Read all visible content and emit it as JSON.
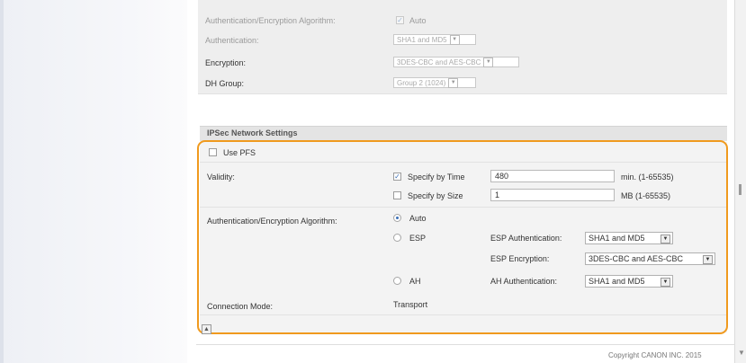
{
  "top_section": {
    "rows": [
      {
        "label": "Authentication/Encryption Algorithm:",
        "value": "Auto",
        "faded": true,
        "checked": true
      },
      {
        "label": "Authentication:",
        "value": "SHA1 and MD5",
        "faded": false
      },
      {
        "label": "Encryption:",
        "value": "3DES-CBC and AES-CBC",
        "faded": false
      },
      {
        "label": "DH Group:",
        "value": "Group 2 (1024)",
        "faded": false
      }
    ]
  },
  "ipsec": {
    "title": "IPSec Network Settings",
    "use_pfs": {
      "label": "Use PFS",
      "checked": false
    },
    "validity": {
      "label": "Validity:",
      "by_time": {
        "label": "Specify by Time",
        "checked": true,
        "value": "480",
        "unit": "min. (1-65535)"
      },
      "by_size": {
        "label": "Specify by Size",
        "checked": false,
        "value": "1",
        "unit": "MB (1-65535)"
      }
    },
    "auth_enc": {
      "label": "Authentication/Encryption Algorithm:",
      "auto": {
        "label": "Auto",
        "selected": true
      },
      "esp": {
        "label": "ESP",
        "selected": false,
        "auth_label": "ESP Authentication:",
        "auth_value": "SHA1 and MD5",
        "enc_label": "ESP Encryption:",
        "enc_value": "3DES-CBC and AES-CBC"
      },
      "ah": {
        "label": "AH",
        "selected": false,
        "auth_label": "AH Authentication:",
        "auth_value": "SHA1 and MD5"
      }
    },
    "connection_mode": {
      "label": "Connection Mode:",
      "value": "Transport"
    }
  },
  "footer": {
    "copyright": "Copyright CANON INC. 2015"
  },
  "colors": {
    "highlight": "#f09a1e",
    "checkmark": "#3b6fb6"
  }
}
